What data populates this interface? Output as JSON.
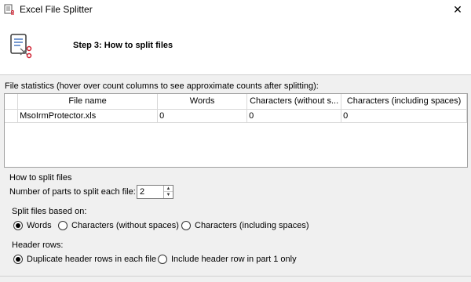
{
  "window": {
    "title": "Excel File Splitter",
    "app_icon": "excel-splitter-icon",
    "close_glyph": "✕"
  },
  "header": {
    "step_title": "Step 3: How to split files",
    "icon": "split-document-icon"
  },
  "stats": {
    "label": "File statistics (hover over count columns to see approximate counts after splitting):",
    "columns": [
      "File name",
      "Words",
      "Characters (without s...",
      "Characters (including spaces)"
    ],
    "rows": [
      {
        "file_name": "MsoIrmProtector.xls",
        "words": "0",
        "chars_no_spaces": "0",
        "chars_with_spaces": "0"
      }
    ]
  },
  "split": {
    "group_title": "How to split files",
    "parts_label": "Number of parts to split each file:",
    "parts_value": "2",
    "based_on_label": "Split files based on:",
    "based_on_options": [
      "Words",
      "Characters (without spaces)",
      "Characters (including spaces)"
    ],
    "based_on_selected": "Words",
    "header_rows_label": "Header rows:",
    "header_options": [
      "Duplicate header rows in each file",
      "Include header row in part 1 only"
    ],
    "header_selected": "Duplicate header rows in each file"
  }
}
